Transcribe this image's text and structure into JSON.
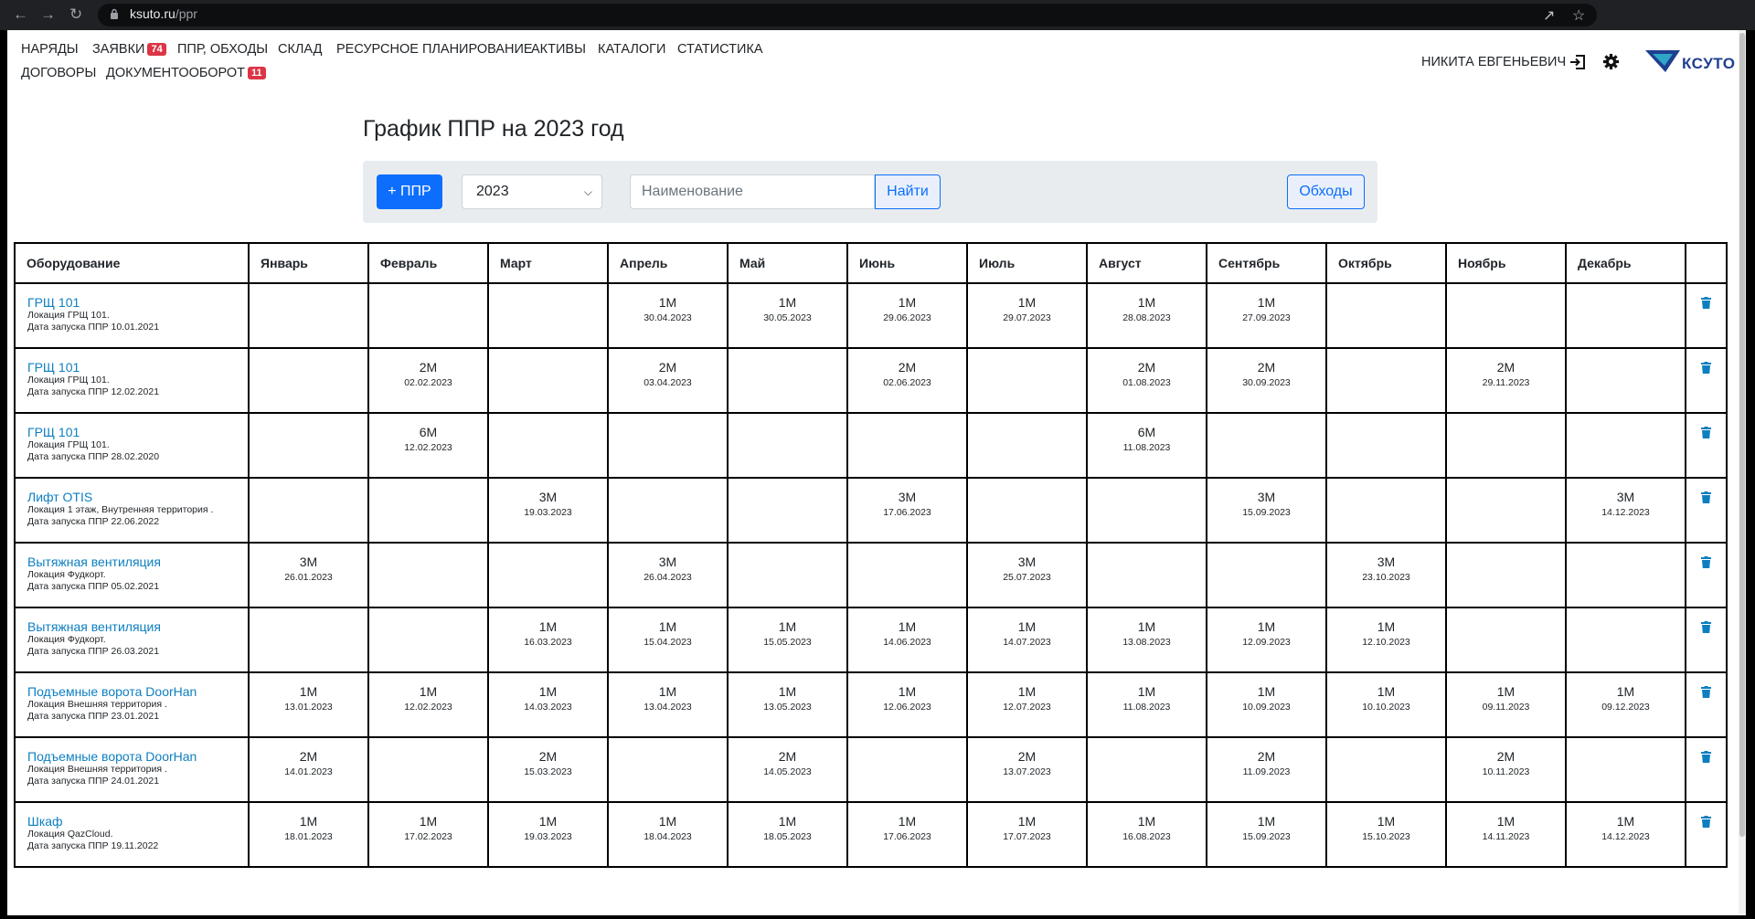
{
  "browser": {
    "domain": "ksuto.ru",
    "path": "/ppr"
  },
  "nav": {
    "items": [
      {
        "label": "НАРЯДЫ"
      },
      {
        "label": "ЗАЯВКИ",
        "badge": "74"
      },
      {
        "label": "ППР, ОБХОДЫ"
      },
      {
        "label": "СКЛАД"
      },
      {
        "label": "РЕСУРСНОЕ ПЛАНИРОВАНИЕ"
      },
      {
        "label": "АКТИВЫ"
      },
      {
        "label": "КАТАЛОГИ"
      },
      {
        "label": "СТАТИСТИКА"
      },
      {
        "label": "ДОГОВОРЫ"
      },
      {
        "label": "ДОКУМЕНТООБОРОТ",
        "badge": "11"
      }
    ],
    "user": "НИКИТА ЕВГЕНЬЕВИЧ",
    "logo_text": "КСУТО"
  },
  "page": {
    "title": "График ППР на 2023 год",
    "add_button": "+ ППР",
    "year_value": "2023",
    "search_placeholder": "Наименование",
    "find_button": "Найти",
    "rounds_button": "Обходы"
  },
  "table": {
    "headers": [
      "Оборудование",
      "Январь",
      "Февраль",
      "Март",
      "Апрель",
      "Май",
      "Июнь",
      "Июль",
      "Август",
      "Сентябрь",
      "Октябрь",
      "Ноябрь",
      "Декабрь"
    ],
    "rows": [
      {
        "name": "ГРЩ 101",
        "location": "Локация ГРЩ 101.",
        "start": "Дата запуска ППР 10.01.2021",
        "cells": [
          null,
          null,
          null,
          {
            "p": "1М",
            "d": "30.04.2023"
          },
          {
            "p": "1М",
            "d": "30.05.2023"
          },
          {
            "p": "1М",
            "d": "29.06.2023"
          },
          {
            "p": "1М",
            "d": "29.07.2023"
          },
          {
            "p": "1М",
            "d": "28.08.2023"
          },
          {
            "p": "1М",
            "d": "27.09.2023"
          },
          null,
          null,
          null
        ]
      },
      {
        "name": "ГРЩ 101",
        "location": "Локация ГРЩ 101.",
        "start": "Дата запуска ППР 12.02.2021",
        "cells": [
          null,
          {
            "p": "2М",
            "d": "02.02.2023"
          },
          null,
          {
            "p": "2М",
            "d": "03.04.2023"
          },
          null,
          {
            "p": "2М",
            "d": "02.06.2023"
          },
          null,
          {
            "p": "2М",
            "d": "01.08.2023"
          },
          {
            "p": "2М",
            "d": "30.09.2023"
          },
          null,
          {
            "p": "2М",
            "d": "29.11.2023"
          },
          null
        ]
      },
      {
        "name": "ГРЩ 101",
        "location": "Локация ГРЩ 101.",
        "start": "Дата запуска ППР 28.02.2020",
        "cells": [
          null,
          {
            "p": "6М",
            "d": "12.02.2023"
          },
          null,
          null,
          null,
          null,
          null,
          {
            "p": "6М",
            "d": "11.08.2023"
          },
          null,
          null,
          null,
          null
        ]
      },
      {
        "name": "Лифт OTIS",
        "location": "Локация 1 этаж, Внутренняя территория .",
        "start": "Дата запуска ППР 22.06.2022",
        "cells": [
          null,
          null,
          {
            "p": "3М",
            "d": "19.03.2023"
          },
          null,
          null,
          {
            "p": "3М",
            "d": "17.06.2023"
          },
          null,
          null,
          {
            "p": "3М",
            "d": "15.09.2023"
          },
          null,
          null,
          {
            "p": "3М",
            "d": "14.12.2023"
          }
        ]
      },
      {
        "name": "Вытяжная вентиляция",
        "location": "Локация Фудкорт.",
        "start": "Дата запуска ППР 05.02.2021",
        "cells": [
          {
            "p": "3М",
            "d": "26.01.2023"
          },
          null,
          null,
          {
            "p": "3М",
            "d": "26.04.2023"
          },
          null,
          null,
          {
            "p": "3М",
            "d": "25.07.2023"
          },
          null,
          null,
          {
            "p": "3М",
            "d": "23.10.2023"
          },
          null,
          null
        ]
      },
      {
        "name": "Вытяжная вентиляция",
        "location": "Локация Фудкорт.",
        "start": "Дата запуска ППР 26.03.2021",
        "cells": [
          null,
          null,
          {
            "p": "1М",
            "d": "16.03.2023"
          },
          {
            "p": "1М",
            "d": "15.04.2023"
          },
          {
            "p": "1М",
            "d": "15.05.2023"
          },
          {
            "p": "1М",
            "d": "14.06.2023"
          },
          {
            "p": "1М",
            "d": "14.07.2023"
          },
          {
            "p": "1М",
            "d": "13.08.2023"
          },
          {
            "p": "1М",
            "d": "12.09.2023"
          },
          {
            "p": "1М",
            "d": "12.10.2023"
          },
          null,
          null
        ]
      },
      {
        "name": "Подъемные ворота DoorHan",
        "location": "Локация Внешняя территория .",
        "start": "Дата запуска ППР 23.01.2021",
        "cells": [
          {
            "p": "1М",
            "d": "13.01.2023"
          },
          {
            "p": "1М",
            "d": "12.02.2023"
          },
          {
            "p": "1М",
            "d": "14.03.2023"
          },
          {
            "p": "1М",
            "d": "13.04.2023"
          },
          {
            "p": "1М",
            "d": "13.05.2023"
          },
          {
            "p": "1М",
            "d": "12.06.2023"
          },
          {
            "p": "1М",
            "d": "12.07.2023"
          },
          {
            "p": "1М",
            "d": "11.08.2023"
          },
          {
            "p": "1М",
            "d": "10.09.2023"
          },
          {
            "p": "1М",
            "d": "10.10.2023"
          },
          {
            "p": "1М",
            "d": "09.11.2023"
          },
          {
            "p": "1М",
            "d": "09.12.2023"
          }
        ]
      },
      {
        "name": "Подъемные ворота DoorHan",
        "location": "Локация Внешняя территория .",
        "start": "Дата запуска ППР 24.01.2021",
        "cells": [
          {
            "p": "2М",
            "d": "14.01.2023"
          },
          null,
          {
            "p": "2М",
            "d": "15.03.2023"
          },
          null,
          {
            "p": "2М",
            "d": "14.05.2023"
          },
          null,
          {
            "p": "2М",
            "d": "13.07.2023"
          },
          null,
          {
            "p": "2М",
            "d": "11.09.2023"
          },
          null,
          {
            "p": "2М",
            "d": "10.11.2023"
          },
          null
        ]
      },
      {
        "name": "Шкаф",
        "location": "Локация QazCloud.",
        "start": "Дата запуска ППР 19.11.2022",
        "cells": [
          {
            "p": "1М",
            "d": "18.01.2023"
          },
          {
            "p": "1М",
            "d": "17.02.2023"
          },
          {
            "p": "1М",
            "d": "19.03.2023"
          },
          {
            "p": "1М",
            "d": "18.04.2023"
          },
          {
            "p": "1М",
            "d": "18.05.2023"
          },
          {
            "p": "1М",
            "d": "17.06.2023"
          },
          {
            "p": "1М",
            "d": "17.07.2023"
          },
          {
            "p": "1М",
            "d": "16.08.2023"
          },
          {
            "p": "1М",
            "d": "15.09.2023"
          },
          {
            "p": "1М",
            "d": "15.10.2023"
          },
          {
            "p": "1М",
            "d": "14.11.2023"
          },
          {
            "p": "1М",
            "d": "14.12.2023"
          }
        ]
      }
    ]
  }
}
